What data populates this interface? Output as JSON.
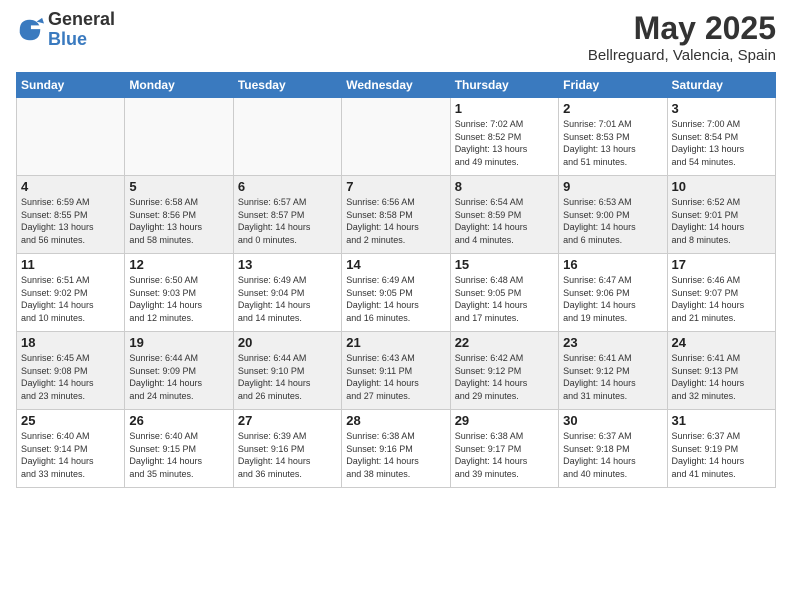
{
  "header": {
    "logo_general": "General",
    "logo_blue": "Blue",
    "month_title": "May 2025",
    "location": "Bellreguard, Valencia, Spain"
  },
  "days_of_week": [
    "Sunday",
    "Monday",
    "Tuesday",
    "Wednesday",
    "Thursday",
    "Friday",
    "Saturday"
  ],
  "weeks": [
    [
      {
        "day": "",
        "info": ""
      },
      {
        "day": "",
        "info": ""
      },
      {
        "day": "",
        "info": ""
      },
      {
        "day": "",
        "info": ""
      },
      {
        "day": "1",
        "info": "Sunrise: 7:02 AM\nSunset: 8:52 PM\nDaylight: 13 hours\nand 49 minutes."
      },
      {
        "day": "2",
        "info": "Sunrise: 7:01 AM\nSunset: 8:53 PM\nDaylight: 13 hours\nand 51 minutes."
      },
      {
        "day": "3",
        "info": "Sunrise: 7:00 AM\nSunset: 8:54 PM\nDaylight: 13 hours\nand 54 minutes."
      }
    ],
    [
      {
        "day": "4",
        "info": "Sunrise: 6:59 AM\nSunset: 8:55 PM\nDaylight: 13 hours\nand 56 minutes."
      },
      {
        "day": "5",
        "info": "Sunrise: 6:58 AM\nSunset: 8:56 PM\nDaylight: 13 hours\nand 58 minutes."
      },
      {
        "day": "6",
        "info": "Sunrise: 6:57 AM\nSunset: 8:57 PM\nDaylight: 14 hours\nand 0 minutes."
      },
      {
        "day": "7",
        "info": "Sunrise: 6:56 AM\nSunset: 8:58 PM\nDaylight: 14 hours\nand 2 minutes."
      },
      {
        "day": "8",
        "info": "Sunrise: 6:54 AM\nSunset: 8:59 PM\nDaylight: 14 hours\nand 4 minutes."
      },
      {
        "day": "9",
        "info": "Sunrise: 6:53 AM\nSunset: 9:00 PM\nDaylight: 14 hours\nand 6 minutes."
      },
      {
        "day": "10",
        "info": "Sunrise: 6:52 AM\nSunset: 9:01 PM\nDaylight: 14 hours\nand 8 minutes."
      }
    ],
    [
      {
        "day": "11",
        "info": "Sunrise: 6:51 AM\nSunset: 9:02 PM\nDaylight: 14 hours\nand 10 minutes."
      },
      {
        "day": "12",
        "info": "Sunrise: 6:50 AM\nSunset: 9:03 PM\nDaylight: 14 hours\nand 12 minutes."
      },
      {
        "day": "13",
        "info": "Sunrise: 6:49 AM\nSunset: 9:04 PM\nDaylight: 14 hours\nand 14 minutes."
      },
      {
        "day": "14",
        "info": "Sunrise: 6:49 AM\nSunset: 9:05 PM\nDaylight: 14 hours\nand 16 minutes."
      },
      {
        "day": "15",
        "info": "Sunrise: 6:48 AM\nSunset: 9:05 PM\nDaylight: 14 hours\nand 17 minutes."
      },
      {
        "day": "16",
        "info": "Sunrise: 6:47 AM\nSunset: 9:06 PM\nDaylight: 14 hours\nand 19 minutes."
      },
      {
        "day": "17",
        "info": "Sunrise: 6:46 AM\nSunset: 9:07 PM\nDaylight: 14 hours\nand 21 minutes."
      }
    ],
    [
      {
        "day": "18",
        "info": "Sunrise: 6:45 AM\nSunset: 9:08 PM\nDaylight: 14 hours\nand 23 minutes."
      },
      {
        "day": "19",
        "info": "Sunrise: 6:44 AM\nSunset: 9:09 PM\nDaylight: 14 hours\nand 24 minutes."
      },
      {
        "day": "20",
        "info": "Sunrise: 6:44 AM\nSunset: 9:10 PM\nDaylight: 14 hours\nand 26 minutes."
      },
      {
        "day": "21",
        "info": "Sunrise: 6:43 AM\nSunset: 9:11 PM\nDaylight: 14 hours\nand 27 minutes."
      },
      {
        "day": "22",
        "info": "Sunrise: 6:42 AM\nSunset: 9:12 PM\nDaylight: 14 hours\nand 29 minutes."
      },
      {
        "day": "23",
        "info": "Sunrise: 6:41 AM\nSunset: 9:12 PM\nDaylight: 14 hours\nand 31 minutes."
      },
      {
        "day": "24",
        "info": "Sunrise: 6:41 AM\nSunset: 9:13 PM\nDaylight: 14 hours\nand 32 minutes."
      }
    ],
    [
      {
        "day": "25",
        "info": "Sunrise: 6:40 AM\nSunset: 9:14 PM\nDaylight: 14 hours\nand 33 minutes."
      },
      {
        "day": "26",
        "info": "Sunrise: 6:40 AM\nSunset: 9:15 PM\nDaylight: 14 hours\nand 35 minutes."
      },
      {
        "day": "27",
        "info": "Sunrise: 6:39 AM\nSunset: 9:16 PM\nDaylight: 14 hours\nand 36 minutes."
      },
      {
        "day": "28",
        "info": "Sunrise: 6:38 AM\nSunset: 9:16 PM\nDaylight: 14 hours\nand 38 minutes."
      },
      {
        "day": "29",
        "info": "Sunrise: 6:38 AM\nSunset: 9:17 PM\nDaylight: 14 hours\nand 39 minutes."
      },
      {
        "day": "30",
        "info": "Sunrise: 6:37 AM\nSunset: 9:18 PM\nDaylight: 14 hours\nand 40 minutes."
      },
      {
        "day": "31",
        "info": "Sunrise: 6:37 AM\nSunset: 9:19 PM\nDaylight: 14 hours\nand 41 minutes."
      }
    ]
  ]
}
